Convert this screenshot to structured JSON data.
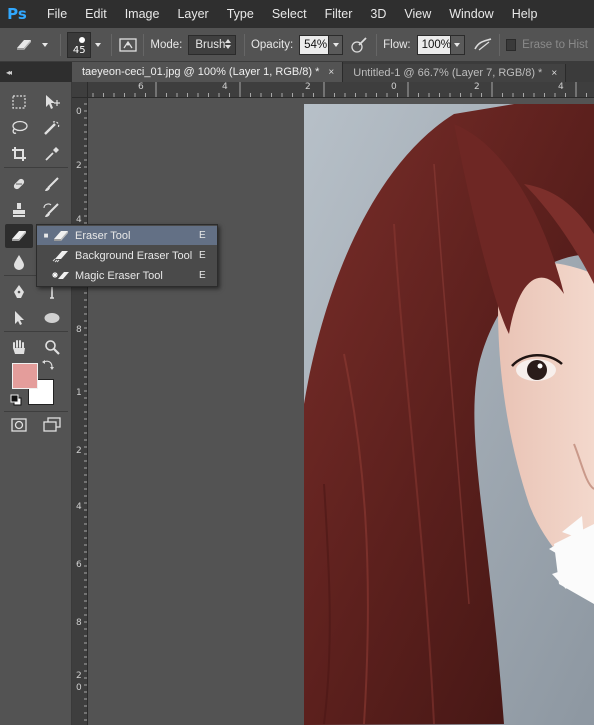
{
  "app": {
    "logo": "Ps"
  },
  "menu": [
    "File",
    "Edit",
    "Image",
    "Layer",
    "Type",
    "Select",
    "Filter",
    "3D",
    "View",
    "Window",
    "Help"
  ],
  "options": {
    "brush_size": "45",
    "mode_label": "Mode:",
    "mode_value": "Brush",
    "opacity_label": "Opacity:",
    "opacity_value": "54%",
    "flow_label": "Flow:",
    "flow_value": "100%",
    "erase_history_label": "Erase to Hist"
  },
  "tabs": [
    {
      "label": "taeyeon-ceci_01.jpg @ 100% (Layer 1, RGB/8) *",
      "close": "×",
      "active": true
    },
    {
      "label": "Untitled-1 @ 66.7% (Layer 7, RGB/8) *",
      "close": "×",
      "active": false
    }
  ],
  "flyout": {
    "items": [
      {
        "bullet": "■",
        "label": "Eraser Tool",
        "key": "E",
        "selected": true
      },
      {
        "bullet": "",
        "label": "Background Eraser Tool",
        "key": "E",
        "selected": false
      },
      {
        "bullet": "",
        "label": "Magic Eraser Tool",
        "key": "E",
        "selected": false
      }
    ]
  },
  "rulers": {
    "top": [
      "6",
      "4",
      "2",
      "0",
      "2",
      "4",
      "6"
    ],
    "left": [
      "0",
      "2",
      "4",
      "6",
      "8",
      "1",
      "2",
      "4",
      "6",
      "8",
      "2",
      "0"
    ]
  },
  "colors": {
    "foreground": "#e49d9b",
    "background": "#ffffff",
    "accent": "#31a8ff",
    "flyout_selected": "#637085"
  },
  "icons": [
    "marquee-icon",
    "move-icon",
    "lasso-icon",
    "quick-select-icon",
    "crop-icon",
    "eyedropper-icon",
    "healing-brush-icon",
    "brush-icon",
    "clone-stamp-icon",
    "history-brush-icon",
    "eraser-icon",
    "gradient-icon",
    "blur-icon",
    "dodge-icon",
    "pen-icon",
    "type-icon",
    "path-select-icon",
    "ellipse-icon",
    "hand-icon",
    "zoom-icon",
    "swap-colors-icon",
    "default-colors-icon",
    "quick-mask-icon",
    "screen-mode-icon"
  ]
}
